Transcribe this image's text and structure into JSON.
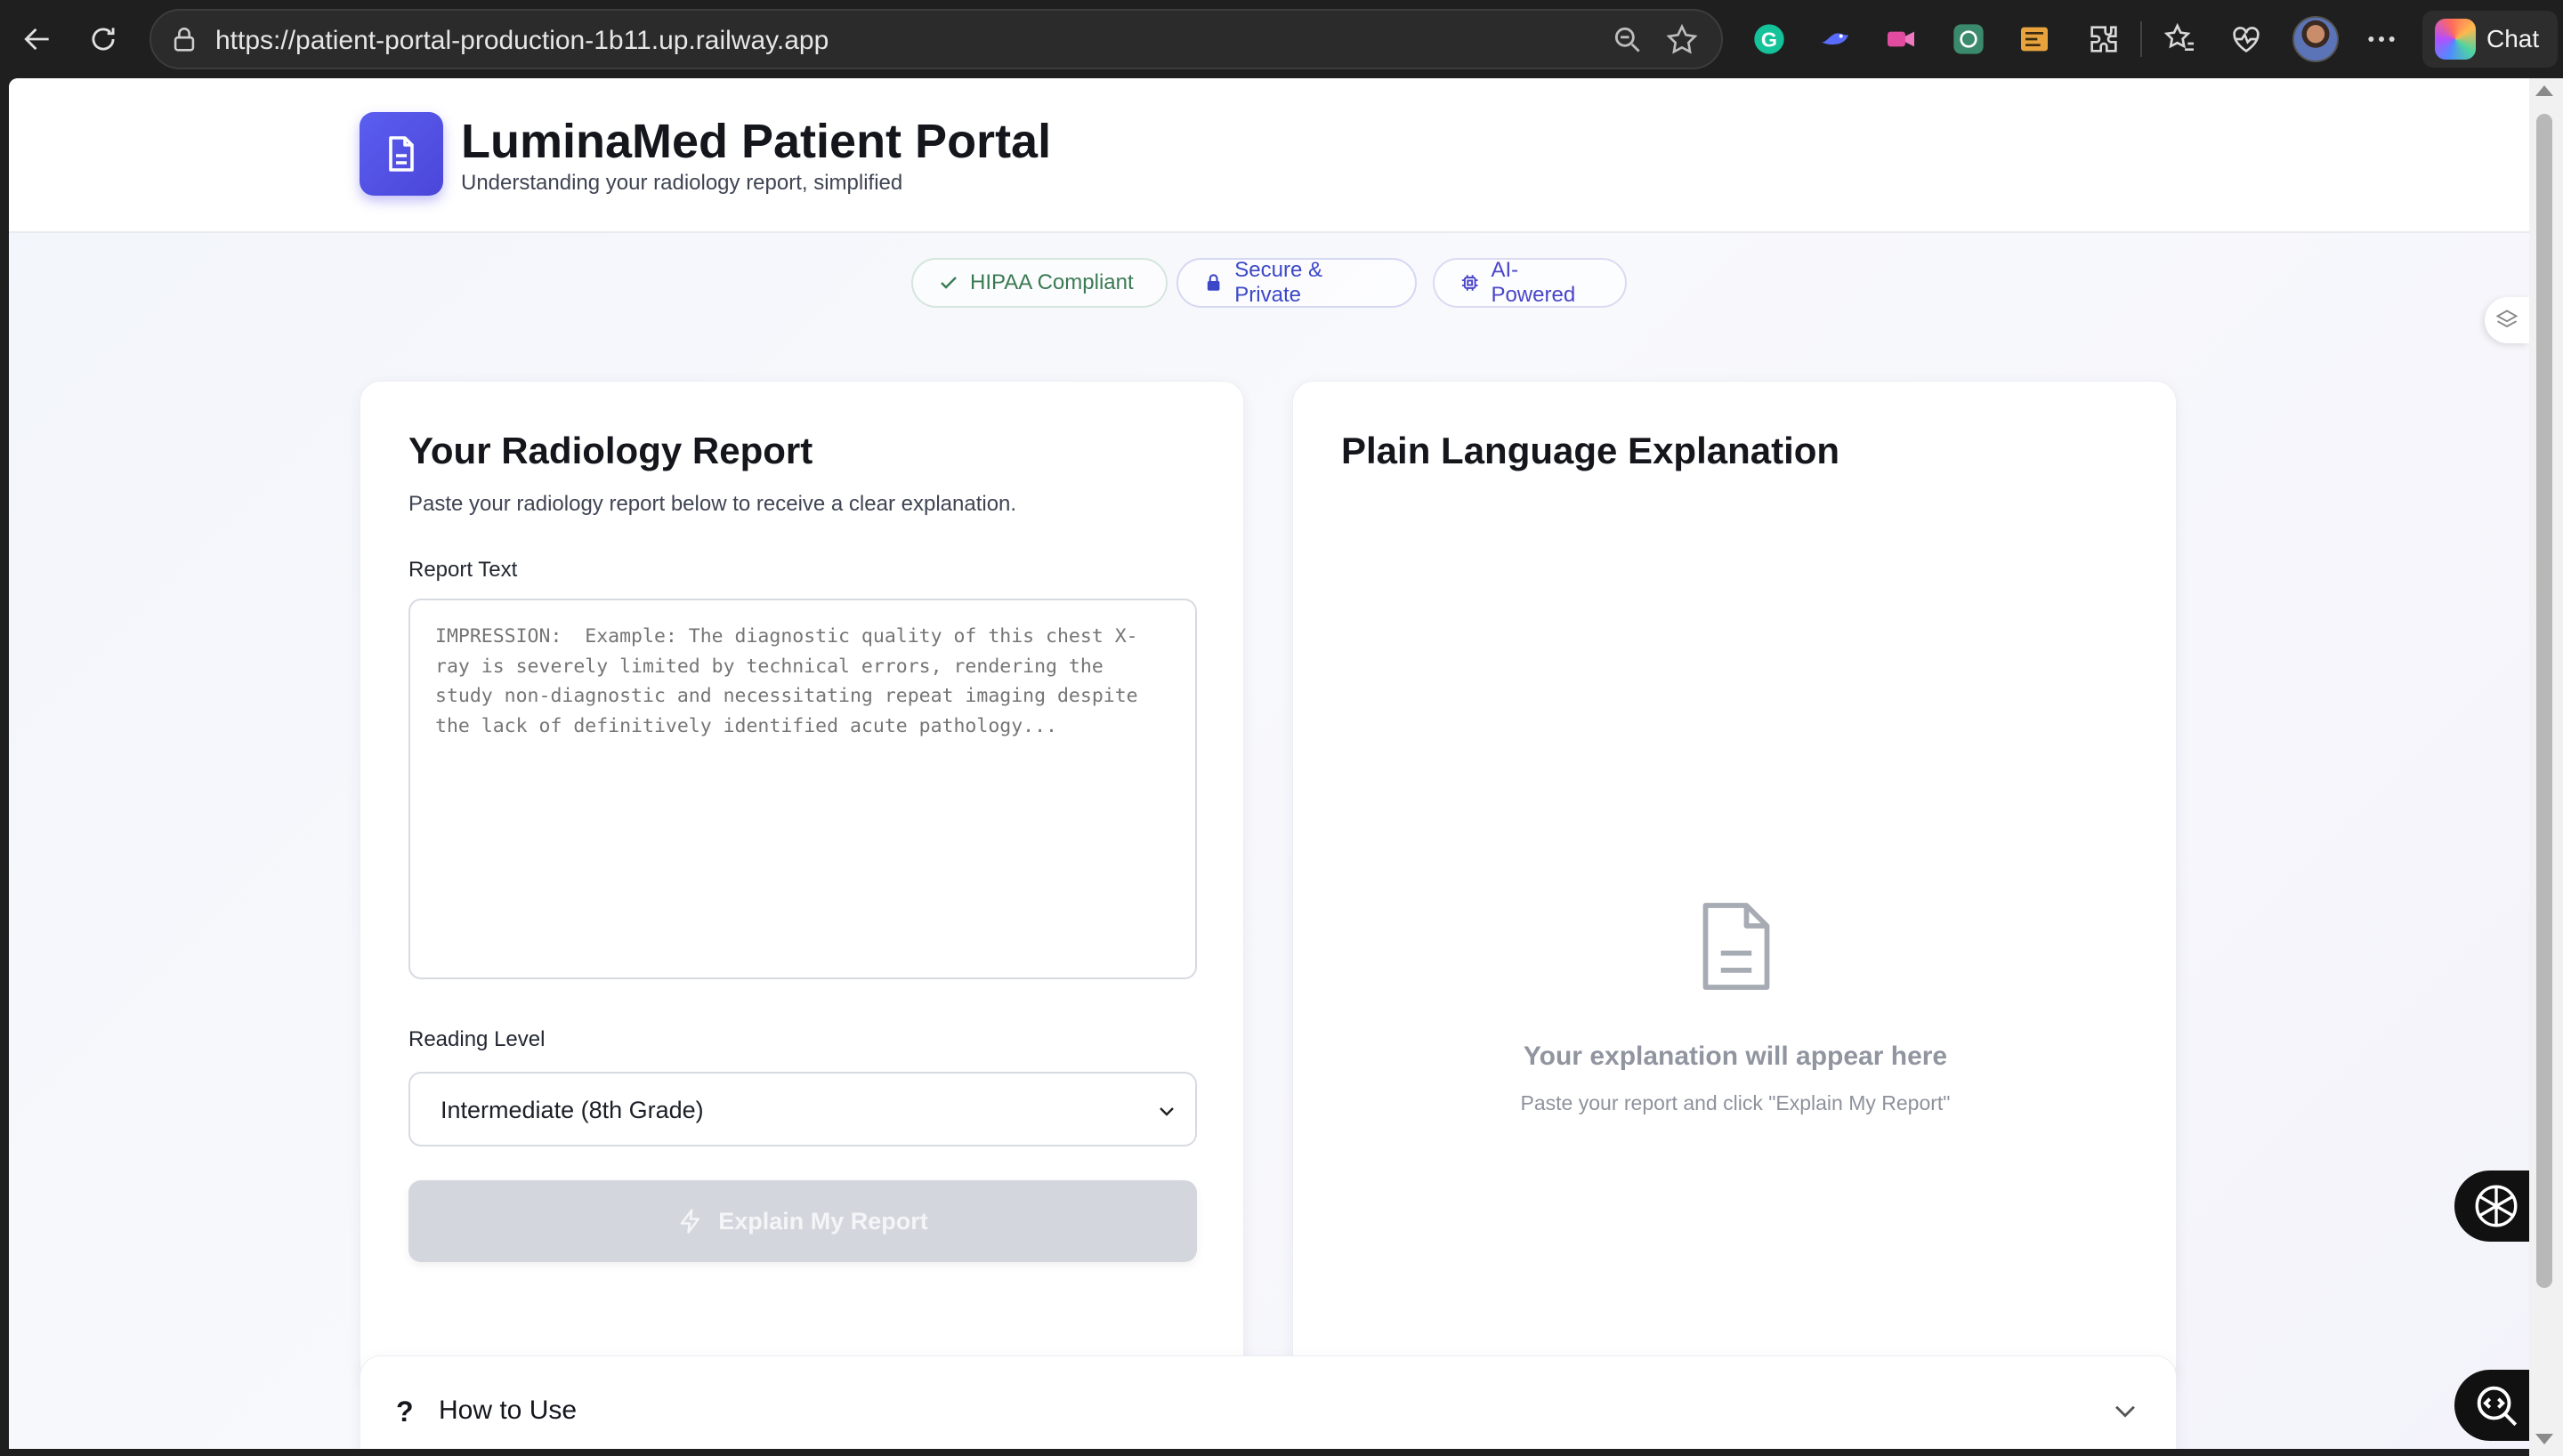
{
  "browser": {
    "url": "https://patient-portal-production-1b11.up.railway.app",
    "chat_label": "Chat"
  },
  "header": {
    "title": "LuminaMed Patient Portal",
    "subtitle": "Understanding your radiology report, simplified"
  },
  "badges": {
    "hipaa": "HIPAA Compliant",
    "secure": "Secure & Private",
    "ai": "AI-Powered"
  },
  "report_card": {
    "title": "Your Radiology Report",
    "description": "Paste your radiology report below to receive a clear explanation.",
    "report_label": "Report Text",
    "report_value": "",
    "report_placeholder": "IMPRESSION:  Example: The diagnostic quality of this chest X-ray is severely limited by technical errors, rendering the study non-diagnostic and necessitating repeat imaging despite the lack of definitively identified acute pathology...",
    "reading_level_label": "Reading Level",
    "reading_level_selected": "Intermediate (8th Grade)",
    "explain_button": "Explain My Report"
  },
  "explanation_card": {
    "title": "Plain Language Explanation",
    "empty_title": "Your explanation will appear here",
    "empty_subtitle": "Paste your report and click \"Explain My Report\""
  },
  "how_to_use": {
    "label": "How to Use"
  },
  "colors": {
    "brand": "#4f46e5",
    "hipaa_green": "#3a7a53",
    "secure_blue": "#3c48c8",
    "button_disabled": "#d3d6dc"
  }
}
